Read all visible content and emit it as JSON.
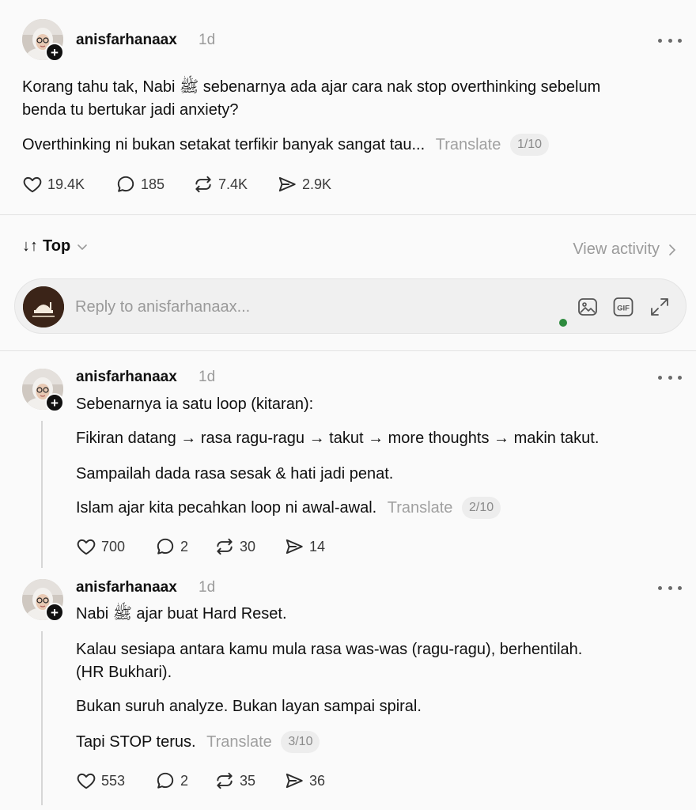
{
  "post": {
    "username": "anisfarhanaax",
    "time": "1d",
    "paragraphs": [
      "Korang tahu tak, Nabi ﷺ sebenarnya ada ajar cara nak stop overthinking sebelum",
      "benda tu bertukar jadi anxiety?",
      "Overthinking ni bukan setakat terfikir banyak sangat tau..."
    ],
    "translate_label": "Translate",
    "page_counter": "1/10",
    "likes": "19.4K",
    "replies": "185",
    "reposts": "7.4K",
    "shares": "2.9K"
  },
  "sort": {
    "label": "Top",
    "view_activity": "View activity"
  },
  "composer": {
    "placeholder": "Reply to anisfarhanaax..."
  },
  "replies": [
    {
      "username": "anisfarhanaax",
      "time": "1d",
      "paragraphs": [
        "Sebenarnya ia satu loop (kitaran):",
        "Fikiran datang → rasa ragu-ragu → takut → more thoughts → makin takut.",
        "Sampailah dada rasa sesak & hati jadi penat.",
        "Islam ajar kita pecahkan loop ni awal-awal."
      ],
      "translate_label": "Translate",
      "page_counter": "2/10",
      "likes": "700",
      "replies": "2",
      "reposts": "30",
      "shares": "14"
    },
    {
      "username": "anisfarhanaax",
      "time": "1d",
      "paragraphs": [
        "Nabi ﷺ ajar buat Hard Reset.",
        "Kalau sesiapa antara kamu mula rasa was-was (ragu-ragu), berhentilah.",
        "(HR Bukhari).",
        "Bukan suruh analyze. Bukan layan sampai spiral.",
        "Tapi STOP terus."
      ],
      "translate_label": "Translate",
      "page_counter": "3/10",
      "likes": "553",
      "replies": "2",
      "reposts": "35",
      "shares": "36"
    }
  ]
}
